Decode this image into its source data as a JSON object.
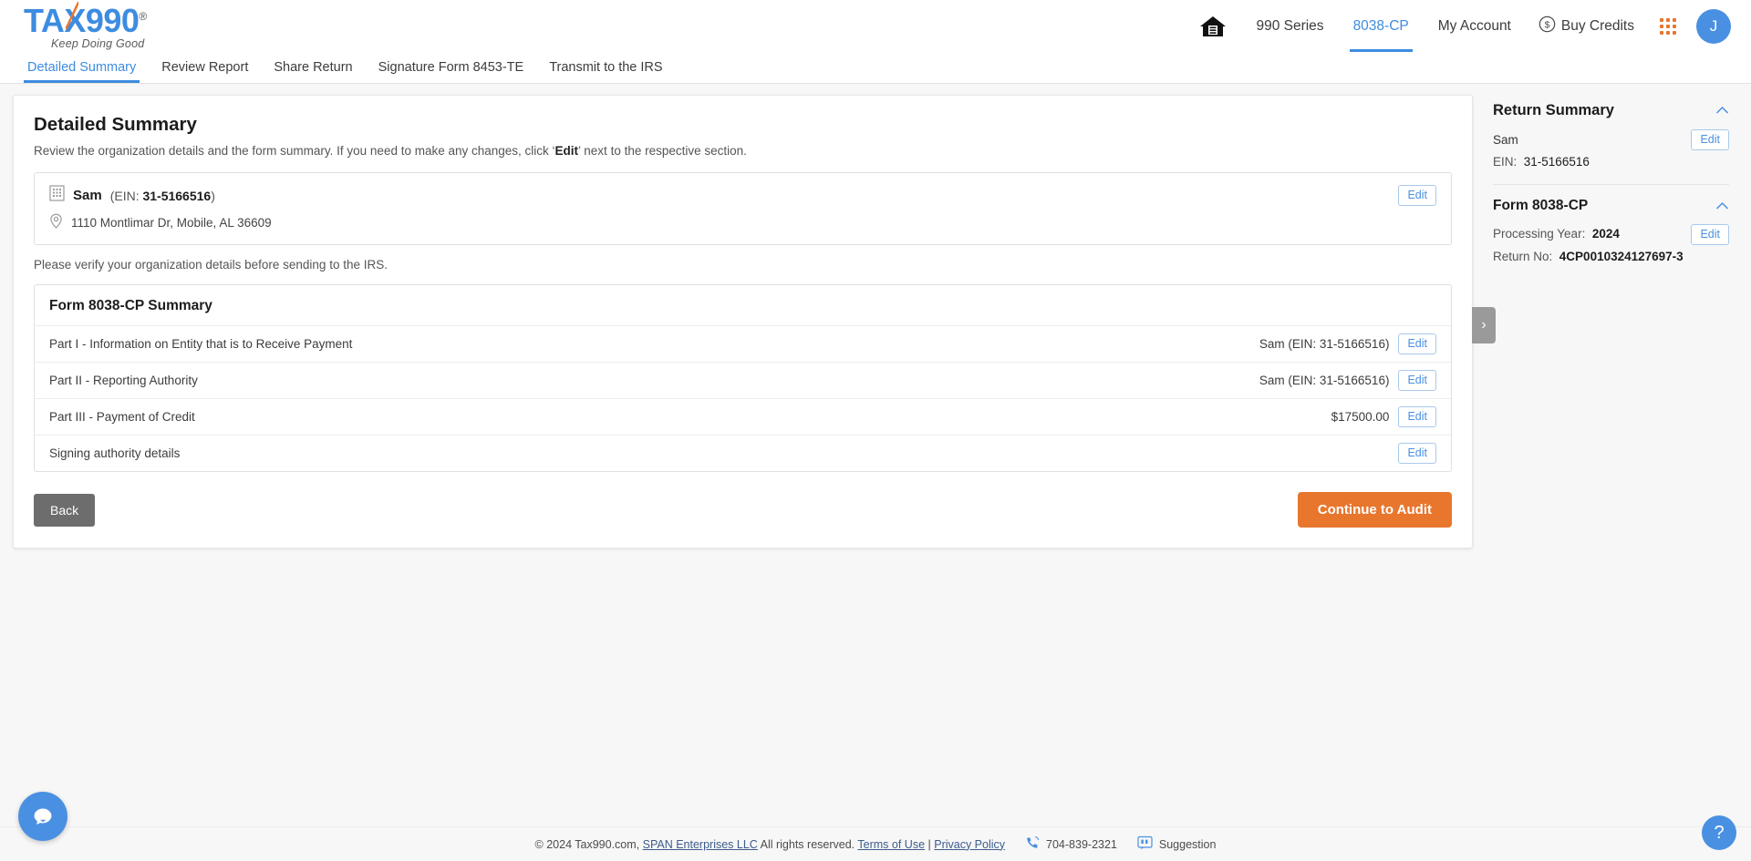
{
  "brand": {
    "logo_text_1": "TA",
    "logo_text_x": "X",
    "logo_text_2": "990",
    "logo_reg": "®",
    "tagline": "Keep Doing Good",
    "accent_blue": "#3d8ce0",
    "accent_orange": "#e8762d"
  },
  "header": {
    "home_icon": "home-icon",
    "nav": [
      {
        "label": "990 Series",
        "active": false
      },
      {
        "label": "8038-CP",
        "active": true
      },
      {
        "label": "My Account",
        "active": false
      }
    ],
    "buy_credits": "Buy Credits",
    "buy_credits_icon": "dollar-circle-icon",
    "apps_icon": "apps-grid-icon",
    "avatar_initial": "J"
  },
  "tabs": [
    {
      "label": "Detailed Summary",
      "active": true
    },
    {
      "label": "Review Report",
      "active": false
    },
    {
      "label": "Share Return",
      "active": false
    },
    {
      "label": "Signature Form 8453-TE",
      "active": false
    },
    {
      "label": "Transmit to the IRS",
      "active": false
    }
  ],
  "main": {
    "title": "Detailed Summary",
    "subtitle_pre": "Review the organization details and the form summary. If you need to make any changes, click ‘",
    "subtitle_bold": "Edit",
    "subtitle_post": "’ next to the respective section.",
    "organization": {
      "building_icon": "building-icon",
      "name": "Sam",
      "ein_prefix": "(EIN: ",
      "ein": "31-5166516",
      "ein_suffix": ")",
      "location_icon": "location-pin-icon",
      "address": "1110 Montlimar Dr, Mobile, AL 36609",
      "edit_label": "Edit"
    },
    "verify_note": "Please verify your organization details before sending to the IRS.",
    "summary": {
      "title": "Form 8038-CP Summary",
      "rows": [
        {
          "label": "Part I - Information on Entity that is to Receive Payment",
          "value": "Sam (EIN: 31-5166516)",
          "edit_label": "Edit"
        },
        {
          "label": "Part II - Reporting Authority",
          "value": "Sam (EIN: 31-5166516)",
          "edit_label": "Edit"
        },
        {
          "label": "Part III - Payment of Credit",
          "value": "$17500.00",
          "edit_label": "Edit"
        },
        {
          "label": "Signing authority details",
          "value": "",
          "edit_label": "Edit"
        }
      ]
    },
    "back_label": "Back",
    "continue_label": "Continue to Audit",
    "side_toggle_icon": "chevron-right-icon"
  },
  "sidebar": {
    "title": "Return Summary",
    "collapse_icon": "chevron-up-icon",
    "org_name": "Sam",
    "org_edit_label": "Edit",
    "ein_label": "EIN:",
    "ein_value": "31-5166516",
    "form_title": "Form 8038-CP",
    "form_collapse_icon": "chevron-up-icon",
    "processing_year_label": "Processing Year:",
    "processing_year_value": "2024",
    "form_edit_label": "Edit",
    "return_no_label": "Return No:",
    "return_no_value": "4CP0010324127697-3"
  },
  "footer": {
    "copyright_pre": "© 2024 Tax990.com, ",
    "company_link": "SPAN Enterprises LLC",
    "copyright_post": " All rights reserved. ",
    "terms": "Terms of Use",
    "separator": "|",
    "privacy": "Privacy Policy",
    "phone_icon": "phone-icon",
    "phone": "704-839-2321",
    "suggestion_icon": "quote-chat-icon",
    "suggestion": "Suggestion"
  },
  "widgets": {
    "chat_icon": "chat-bubble-icon",
    "help_label": "?"
  }
}
